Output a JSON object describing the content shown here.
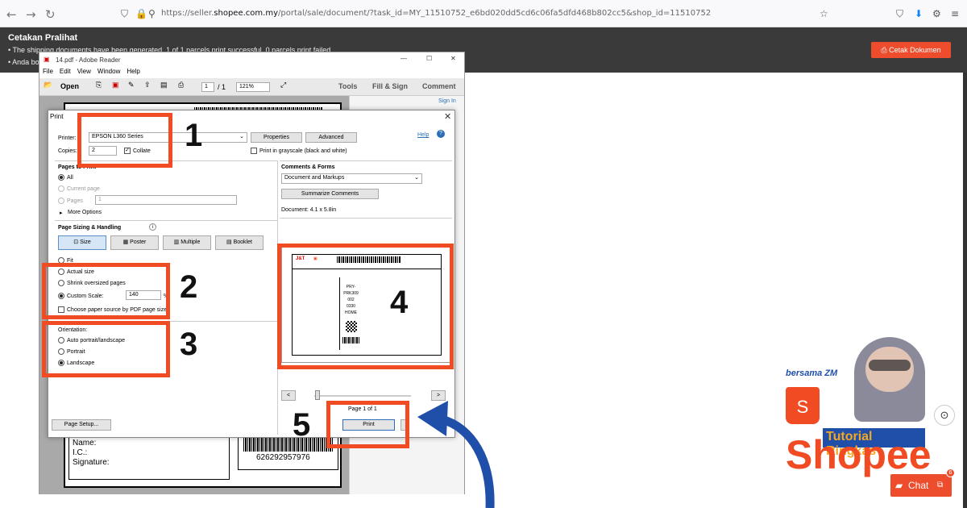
{
  "browser": {
    "url_prefix": "https://seller.",
    "url_domain": "shopee.com.my",
    "url_rest": "/portal/sale/document/?task_id=MY_11510752_e6bd020dd5cd6c06fa5dfd468b802cc5&shop_id=11510752"
  },
  "page": {
    "title": "Cetakan Pralihat",
    "line1": "• The shipping documents have been generated. 1 of 1 parcels print successful, 0 parcels print failed.",
    "line2": "• Anda bo",
    "print_button": "Cetak Dokumen"
  },
  "adobe": {
    "title": "14.pdf - Adobe Reader",
    "menu": [
      "File",
      "Edit",
      "View",
      "Window",
      "Help"
    ],
    "open": "Open",
    "page_num": "1",
    "page_total": "/ 1",
    "zoom": "121%",
    "tools": "Tools",
    "fill_sign": "Fill & Sign",
    "comment": "Comment",
    "sign_in": "Sign In",
    "doc_name_label": "Name:",
    "doc_ic_label": "I.C.:",
    "doc_sig_label": "Signature:",
    "doc_tracking": "626292957976"
  },
  "print": {
    "title": "Print",
    "printer_label": "Printer:",
    "printer_value": "EPSON L360 Series",
    "properties": "Properties",
    "advanced": "Advanced",
    "help": "Help",
    "copies_label": "Copies:",
    "copies_value": "2",
    "collate": "Collate",
    "grayscale": "Print in grayscale (black and white)",
    "pages_to_print": "Pages to Print",
    "all": "All",
    "current_page": "Current page",
    "pages": "Pages",
    "pages_value": "1",
    "more_options": "More Options",
    "sizing": "Page Sizing & Handling",
    "size": "Size",
    "poster": "Poster",
    "multiple": "Multiple",
    "booklet": "Booklet",
    "fit": "Fit",
    "actual_size": "Actual size",
    "shrink": "Shrink oversized pages",
    "custom_scale": "Custom Scale:",
    "scale_value": "140",
    "percent": "%",
    "paper_source": "Choose paper source by PDF page size",
    "orientation": "Orientation:",
    "auto": "Auto portrait/landscape",
    "portrait": "Portrait",
    "landscape": "Landscape",
    "comments_forms": "Comments & Forms",
    "comments_value": "Document and Markups",
    "summarize": "Summarize Comments",
    "document_size": "Document: 4.1 x 5.8in",
    "page_of": "Page 1 of 1",
    "print_btn": "Print",
    "page_setup": "Page Setup..."
  },
  "preview": {
    "route": "PRY-PRK309",
    "code": "002",
    "num": "0330",
    "home": "HOME"
  },
  "annotations": [
    "1",
    "2",
    "3",
    "4",
    "5"
  ],
  "branding": {
    "bersama": "bersama ZM",
    "tutorial": "Tutorial Ringkas",
    "shopee": "Shopee",
    "chat": "Chat",
    "chat_badge": "6"
  }
}
